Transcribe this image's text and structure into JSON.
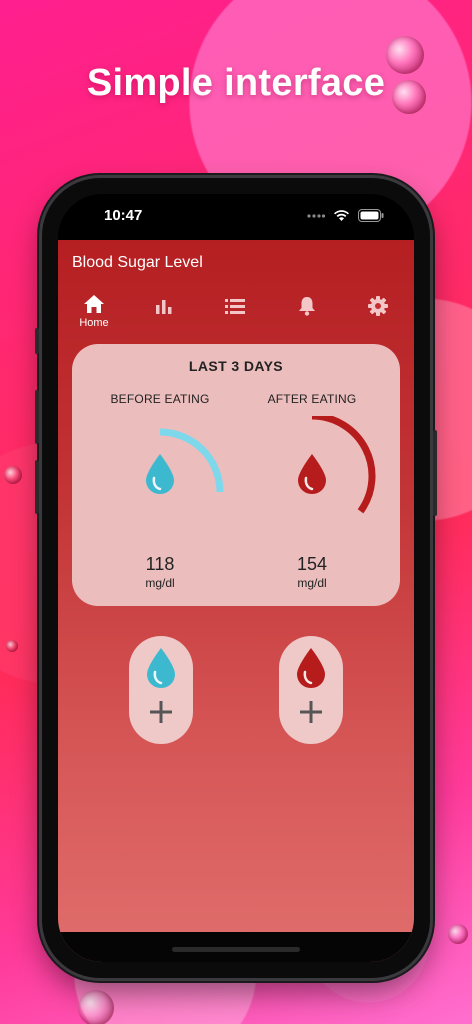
{
  "promo": {
    "headline": "Simple interface"
  },
  "status_bar": {
    "time": "10:47"
  },
  "app": {
    "title": "Blood Sugar Level",
    "nav": [
      {
        "id": "home",
        "label": "Home",
        "icon": "home-icon",
        "active": true
      },
      {
        "id": "charts",
        "label": "",
        "icon": "bar-chart-icon",
        "active": false
      },
      {
        "id": "list",
        "label": "",
        "icon": "list-icon",
        "active": false
      },
      {
        "id": "reminders",
        "label": "",
        "icon": "bell-icon",
        "active": false
      },
      {
        "id": "settings",
        "label": "",
        "icon": "gear-icon",
        "active": false
      }
    ]
  },
  "summary": {
    "title": "LAST 3 DAYS",
    "before": {
      "label": "BEFORE EATING",
      "value": "118",
      "unit": "mg/dl",
      "gauge_fraction": 0.25,
      "color": "#7dd8ec",
      "icon": "blue-drop-icon"
    },
    "after": {
      "label": "AFTER EATING",
      "value": "154",
      "unit": "mg/dl",
      "gauge_fraction": 0.35,
      "color": "#b71c1c",
      "icon": "red-drop-icon"
    }
  },
  "actions": {
    "add_before_icon": "blue-drop-icon",
    "add_after_icon": "red-drop-icon",
    "add_symbol": "plus-icon"
  },
  "colors": {
    "app_top": "#b51f22",
    "app_bottom": "#e06f6d",
    "card_bg": "#ecbdbd",
    "blue_drop": "#3db9cf",
    "red_drop": "#b71c1c"
  }
}
